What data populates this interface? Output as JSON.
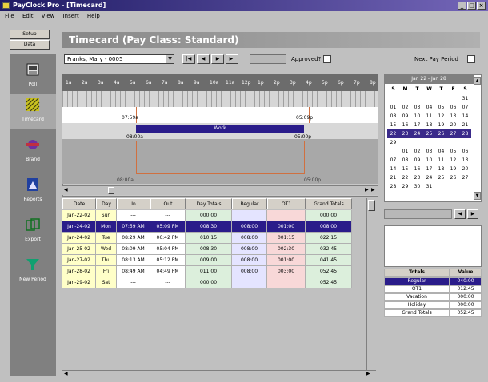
{
  "window": {
    "title": "PayClock Pro - [Timecard]"
  },
  "menu": [
    "File",
    "Edit",
    "View",
    "Insert",
    "Help"
  ],
  "left_tabs": [
    "Setup",
    "Data"
  ],
  "sidebar": [
    {
      "label": "Poll",
      "icon": "poll-icon"
    },
    {
      "label": "Timecard",
      "icon": "timecard-icon"
    },
    {
      "label": "Brand",
      "icon": "brand-icon"
    },
    {
      "label": "Reports",
      "icon": "reports-icon"
    },
    {
      "label": "Export",
      "icon": "export-icon"
    },
    {
      "label": "New Period",
      "icon": "funnel-icon"
    }
  ],
  "heading": "Timecard (Pay Class: Standard)",
  "employee_select": "Franks, Mary - 0005",
  "approved_label": "Approved?",
  "next_period_label": "Next Pay Period",
  "timeline": {
    "hours": [
      "1a",
      "2a",
      "3a",
      "4a",
      "5a",
      "6a",
      "7a",
      "8a",
      "9a",
      "10a",
      "11a",
      "12p",
      "1p",
      "2p",
      "3p",
      "4p",
      "5p",
      "6p",
      "7p",
      "8p"
    ],
    "punch_in": "07:59a",
    "punch_out": "05:09p",
    "bar_label": "Work",
    "seg_in": "08:00a",
    "seg_out": "05:00p",
    "lower_in": "08:00a",
    "lower_out": "05:00p"
  },
  "calendar": {
    "title": "Jan 22 - Jan 28",
    "days": [
      "S",
      "M",
      "T",
      "W",
      "T",
      "F",
      "S"
    ],
    "weeks": [
      [
        "",
        "",
        "",
        "",
        "",
        "",
        "31"
      ],
      [
        "01",
        "02",
        "03",
        "04",
        "05",
        "06",
        "07"
      ],
      [
        "08",
        "09",
        "10",
        "11",
        "12",
        "13",
        "14"
      ],
      [
        "15",
        "16",
        "17",
        "18",
        "19",
        "20",
        "21"
      ],
      [
        "22",
        "23",
        "24",
        "25",
        "26",
        "27",
        "28"
      ],
      [
        "29",
        "",
        "",
        "",
        "",
        "",
        ""
      ],
      [
        "",
        "01",
        "02",
        "03",
        "04",
        "05",
        "06"
      ],
      [
        "07",
        "08",
        "09",
        "10",
        "11",
        "12",
        "13"
      ],
      [
        "14",
        "15",
        "16",
        "17",
        "18",
        "19",
        "20"
      ],
      [
        "21",
        "22",
        "23",
        "24",
        "25",
        "26",
        "27"
      ],
      [
        "28",
        "29",
        "30",
        "31",
        "",
        "",
        ""
      ]
    ]
  },
  "table": {
    "headers": [
      "Date",
      "Day",
      "In",
      "Out",
      "Day Totals",
      "Regular",
      "OT1",
      "Grand Totals"
    ],
    "rows": [
      [
        "Jan-22-02",
        "Sun",
        "---",
        "---",
        "000:00",
        "",
        "",
        "000:00"
      ],
      [
        "Jan-24-02",
        "Mon",
        "07:59 AM",
        "05:09 PM",
        "008:30",
        "008:00",
        "001:00",
        "008:00"
      ],
      [
        "Jan-24-02",
        "Tue",
        "08:29 AM",
        "06:42 PM",
        "010:15",
        "008:00",
        "001:15",
        "022:15"
      ],
      [
        "Jan-25-02",
        "Wed",
        "08:09 AM",
        "05:04 PM",
        "008:30",
        "008:00",
        "002:30",
        "032:45"
      ],
      [
        "Jan-27-02",
        "Thu",
        "08:13 AM",
        "05:12 PM",
        "009:00",
        "008:00",
        "001:00",
        "041:45"
      ],
      [
        "Jan-28-02",
        "Fri",
        "08:49 AM",
        "04:49 PM",
        "011:00",
        "008:00",
        "003:00",
        "052:45"
      ],
      [
        "Jan-29-02",
        "Sat",
        "---",
        "---",
        "000:00",
        "",
        "",
        "052:45"
      ]
    ]
  },
  "totals": {
    "headers": [
      "Totals",
      "Value"
    ],
    "rows": [
      [
        "Regular",
        "040:00"
      ],
      [
        "OT1",
        "012:45"
      ],
      [
        "Vacation",
        "000:00"
      ],
      [
        "Holiday",
        "000:00"
      ],
      [
        "Grand Totals",
        "052:45"
      ]
    ]
  }
}
